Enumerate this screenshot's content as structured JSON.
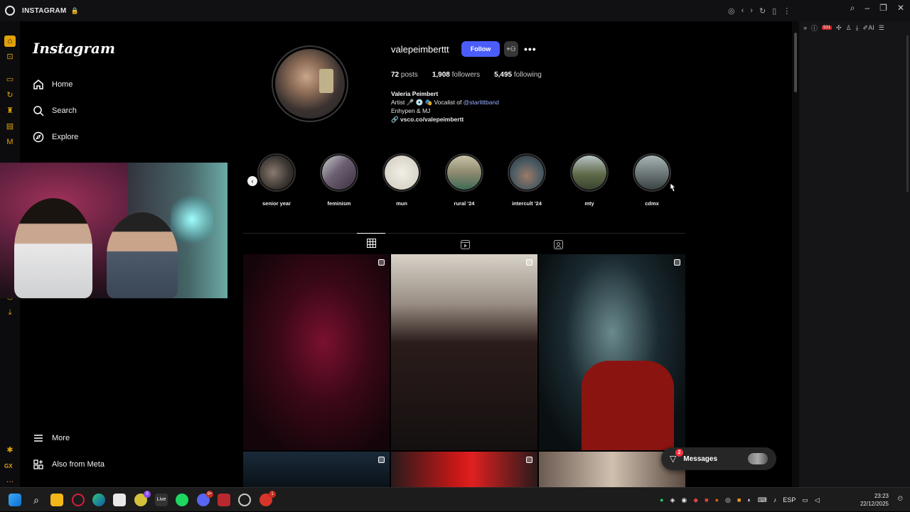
{
  "browser": {
    "tab_title": "INSTAGRAM",
    "accent": "#e0a10a"
  },
  "nav": {
    "logo": "Instagram",
    "items": [
      {
        "label": "Home",
        "icon": "home-icon"
      },
      {
        "label": "Search",
        "icon": "search-icon"
      },
      {
        "label": "Explore",
        "icon": "compass-icon"
      }
    ],
    "bottom_items": [
      {
        "label": "More",
        "icon": "hamburger-icon"
      },
      {
        "label": "Also from Meta",
        "icon": "meta-grid-icon"
      }
    ]
  },
  "profile": {
    "username": "valepeimberttt",
    "follow_label": "Follow",
    "follow_color": "#4a5df9",
    "stats": {
      "posts_count": "72",
      "posts_label": "posts",
      "followers_count": "1,908",
      "followers_label": "followers",
      "following_count": "5,495",
      "following_label": "following"
    },
    "bio": {
      "full_name": "Valeria Peimbert",
      "line1_prefix": "Artist 🎤 💿 🎭 Vocalist of ",
      "mention": "@starlittband",
      "line2": "Enhypen & MJ",
      "link": "vsco.co/valepeimbertt"
    },
    "highlights": [
      {
        "label": "senior year",
        "color": "#3a3530"
      },
      {
        "label": "feminism",
        "color": "#6b5f72"
      },
      {
        "label": "mun",
        "color": "#d8d4c8"
      },
      {
        "label": "rural '24",
        "color": "#8d8a70"
      },
      {
        "label": "intercult '24",
        "color": "#4a5a62"
      },
      {
        "label": "mty",
        "color": "#5e6a48"
      },
      {
        "label": "cdmx",
        "color": "#6f7a7a"
      }
    ]
  },
  "messages": {
    "label": "Messages",
    "badge": "2"
  },
  "taskbar": {
    "language": "ESP",
    "time": "23:23",
    "date": "22/12/2025",
    "badges": {
      "spotify": "1",
      "discord": "9+",
      "opera": "1"
    },
    "rp_badge": "531"
  }
}
